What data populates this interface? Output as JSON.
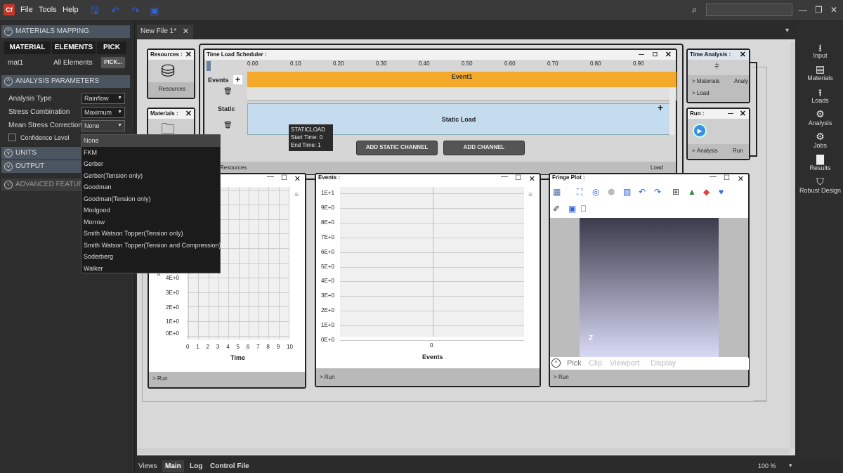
{
  "app": {
    "logo": "Cf",
    "menus": [
      "File",
      "Tools",
      "Help"
    ],
    "tab": "New File 1*"
  },
  "left": {
    "materials_mapping": "MATERIALS MAPPING",
    "tabs": [
      "MATERIAL",
      "ELEMENTS",
      "PICK"
    ],
    "row": {
      "name": "mat1",
      "scope": "All Elements",
      "pick": "PICK..."
    },
    "analysis_parameters": "ANALYSIS PARAMETERS",
    "analysis_type": {
      "label": "Analysis Type",
      "value": "Rainflow"
    },
    "stress_combination": {
      "label": "Stress Combination",
      "value": "Maximum"
    },
    "mean_stress": {
      "label": "Mean Stress Correction",
      "value": "None"
    },
    "confidence": "Confidence Level",
    "units": "UNITS",
    "output": "OUTPUT",
    "advanced": "ADVANCED FEATURE",
    "options": [
      "None",
      "FKM",
      "Gerber",
      "Gerber(Tension only)",
      "Goodman",
      "Goodman(Tension only)",
      "Modgood",
      "Morrow",
      "Smith Watson Topper(Tension only)",
      "Smith Watson Topper(Tension and Compression)",
      "Soderberg",
      "Walker"
    ]
  },
  "resources": {
    "title": "Resources :",
    "port": "Resources"
  },
  "materials": {
    "title": "Materials :"
  },
  "scheduler": {
    "title": "Time Load Scheduler :",
    "ticks": [
      "0.00",
      "0.10",
      "0.20",
      "0.30",
      "0.40",
      "0.50",
      "0.60",
      "0.70",
      "0.80",
      "0.90"
    ],
    "events_label": "Events",
    "event1": "Event1",
    "static_label": "Static",
    "static_load": "Static Load",
    "tooltip": {
      "name": "STATICLOAD",
      "start": "Start Time: 0",
      "end": "End Time: 1"
    },
    "add_static": "ADD STATIC CHANNEL",
    "add_channel": "ADD CHANNEL",
    "resources_port": "Resources",
    "load_port": "Load"
  },
  "time_analysis": {
    "title": "Time Analysis :",
    "materials": "Materials",
    "analy": "Analy",
    "load": "Load"
  },
  "run": {
    "title": "Run :",
    "analysis": "Analysis",
    "run": "Run"
  },
  "plot1": {
    "yticks": [
      "4E+0",
      "3E+0",
      "2E+0",
      "1E+0",
      "0E+0"
    ],
    "xticks": [
      "0",
      "1",
      "2",
      "3",
      "4",
      "5",
      "6",
      "7",
      "8",
      "9",
      "10"
    ],
    "xlabel": "Time",
    "foot": "Run",
    "rlabel": "R"
  },
  "plot2": {
    "title": "Events :",
    "yticks": [
      "1E+1",
      "9E+0",
      "8E+0",
      "7E+0",
      "6E+0",
      "5E+0",
      "4E+0",
      "3E+0",
      "2E+0",
      "1E+0",
      "0E+0"
    ],
    "xtick": "0",
    "xlabel": "Events",
    "foot": "Run"
  },
  "fringe": {
    "title": "Fringe Plot :",
    "bottom": [
      "Pick",
      "Clip",
      "Viewport",
      "Display"
    ],
    "axis": "Z",
    "foot": "Run"
  },
  "right": [
    {
      "icon": "input-icon",
      "label": "Input"
    },
    {
      "icon": "materials-icon",
      "label": "Materials"
    },
    {
      "icon": "loads-icon",
      "label": "Loads"
    },
    {
      "icon": "analysis-icon",
      "label": "Analysis"
    },
    {
      "icon": "jobs-icon",
      "label": "Jobs"
    },
    {
      "icon": "results-icon",
      "label": "Results"
    },
    {
      "icon": "robust-design-icon",
      "label": "Robust Design"
    }
  ],
  "bottom": {
    "views": "Views",
    "main": "Main",
    "log": "Log",
    "control": "Control File",
    "zoom": "100 %"
  }
}
